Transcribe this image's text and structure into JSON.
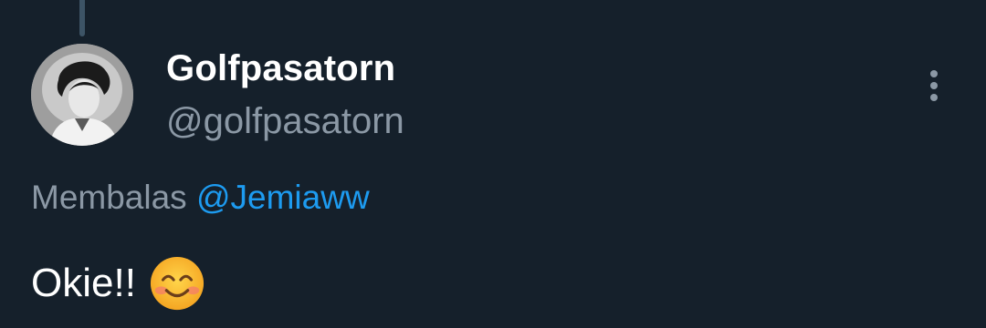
{
  "tweet": {
    "author": {
      "display_name": "Golfpasatorn",
      "handle": "@golfpasatorn",
      "avatar_icon": "avatar-photo"
    },
    "reply": {
      "prefix": "Membalas",
      "mention": "@Jemiaww"
    },
    "text": "Okie!!",
    "emoji_icon": "smiling-face-emoji",
    "more_icon": "more-vertical-icon"
  },
  "colors": {
    "background": "#15202b",
    "primary_text": "#ffffff",
    "secondary_text": "#8b98a5",
    "accent": "#1d9bf0",
    "thread_line": "#3d5466"
  }
}
